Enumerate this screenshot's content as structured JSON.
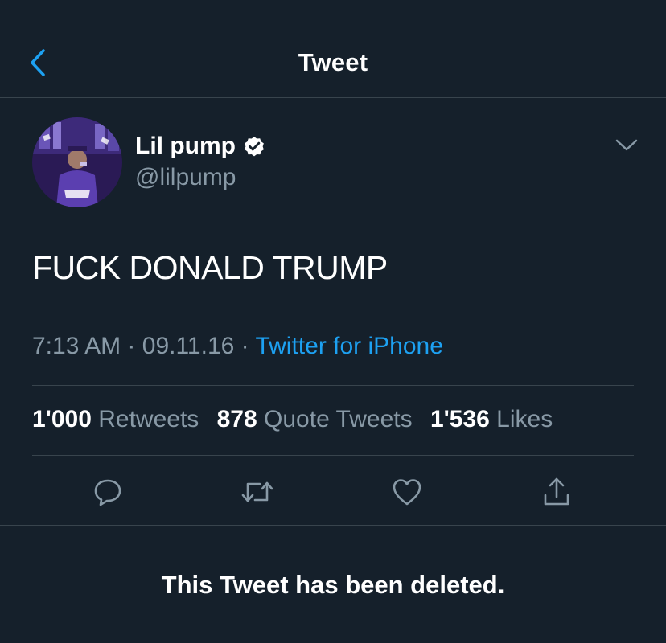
{
  "header": {
    "title": "Tweet",
    "back_icon": "chevron-left-icon"
  },
  "tweet": {
    "author": {
      "display_name": "Lil pump",
      "handle": "@lilpump",
      "verified": true,
      "avatar_icon": "profile-photo"
    },
    "text": "FUCK DONALD TRUMP",
    "time": "7:13 AM",
    "date": "09.11.16",
    "separator": "·",
    "source": "Twitter for iPhone",
    "stats": [
      {
        "count": "1'000",
        "label": "Retweets"
      },
      {
        "count": "878",
        "label": "Quote Tweets"
      },
      {
        "count": "1'536",
        "label": "Likes"
      }
    ],
    "actions": [
      "reply-icon",
      "retweet-icon",
      "like-icon",
      "share-icon"
    ]
  },
  "notice": {
    "text": "This Tweet has been deleted."
  },
  "colors": {
    "background": "#15202b",
    "accent": "#1da1f2",
    "secondary_text": "#8899a6",
    "divider": "#38444d"
  }
}
